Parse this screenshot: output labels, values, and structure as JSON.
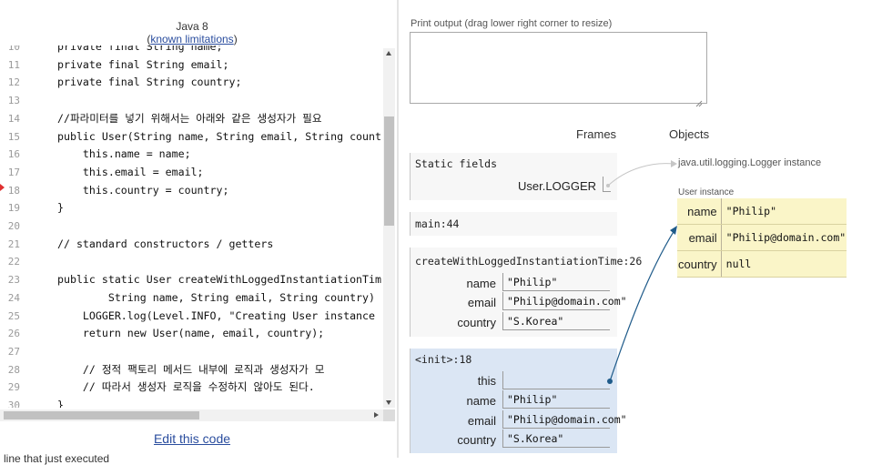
{
  "header": {
    "language": "Java 8",
    "limits_prefix": "(",
    "limits_link": "known limitations",
    "limits_suffix": ")"
  },
  "code": {
    "current_line": 18,
    "lines": [
      {
        "num": "10",
        "text": "private final String name;"
      },
      {
        "num": "11",
        "text": "private final String email;"
      },
      {
        "num": "12",
        "text": "private final String country;"
      },
      {
        "num": "13",
        "text": ""
      },
      {
        "num": "14",
        "text": "//파라미터를 넣기 위해서는 아래와 같은 생성자가 필요"
      },
      {
        "num": "15",
        "text": "public User(String name, String email, String country"
      },
      {
        "num": "16",
        "text": "    this.name = name;"
      },
      {
        "num": "17",
        "text": "    this.email = email;"
      },
      {
        "num": "18",
        "text": "    this.country = country;"
      },
      {
        "num": "19",
        "text": "}"
      },
      {
        "num": "20",
        "text": ""
      },
      {
        "num": "21",
        "text": "// standard constructors / getters"
      },
      {
        "num": "22",
        "text": ""
      },
      {
        "num": "23",
        "text": "public static User createWithLoggedInstantiationTim"
      },
      {
        "num": "24",
        "text": "        String name, String email, String country)"
      },
      {
        "num": "25",
        "text": "    LOGGER.log(Level.INFO, \"Creating User instance"
      },
      {
        "num": "26",
        "text": "    return new User(name, email, country);"
      },
      {
        "num": "27",
        "text": ""
      },
      {
        "num": "28",
        "text": "    // 정적 팩토리 메서드 내부에 로직과 생성자가 모"
      },
      {
        "num": "29",
        "text": "    // 따라서 생성자 로직을 수정하지 않아도 된다."
      },
      {
        "num": "30",
        "text": "}"
      }
    ]
  },
  "links": {
    "edit_code": "Edit this code",
    "legend_hint": "line that just executed"
  },
  "output": {
    "label": "Print output (drag lower right corner to resize)",
    "value": ""
  },
  "viz": {
    "frames_heading": "Frames",
    "objects_heading": "Objects",
    "static": {
      "title": "Static fields",
      "var": "User.LOGGER"
    },
    "main": {
      "title": "main:44"
    },
    "create": {
      "title": "createWithLoggedInstantiationTime:26",
      "vars": [
        {
          "name": "name",
          "value": "\"Philip\""
        },
        {
          "name": "email",
          "value": "\"Philip@domain.com\""
        },
        {
          "name": "country",
          "value": "\"S.Korea\""
        }
      ]
    },
    "init": {
      "title": "<init>:18",
      "vars": [
        {
          "name": "this",
          "value": ""
        },
        {
          "name": "name",
          "value": "\"Philip\""
        },
        {
          "name": "email",
          "value": "\"Philip@domain.com\""
        },
        {
          "name": "country",
          "value": "\"S.Korea\""
        }
      ]
    },
    "logger_object": "java.util.logging.Logger instance",
    "user_object": {
      "label": "User instance",
      "fields": [
        {
          "name": "name",
          "value": "\"Philip\""
        },
        {
          "name": "email",
          "value": "\"Philip@domain.com\""
        },
        {
          "name": "country",
          "value": "null"
        }
      ]
    },
    "colors": {
      "active_frame": "#dbe6f4",
      "object_bg": "#faf5c8",
      "arrow": "#1f5b8a",
      "line_marker": "#e03030"
    }
  }
}
